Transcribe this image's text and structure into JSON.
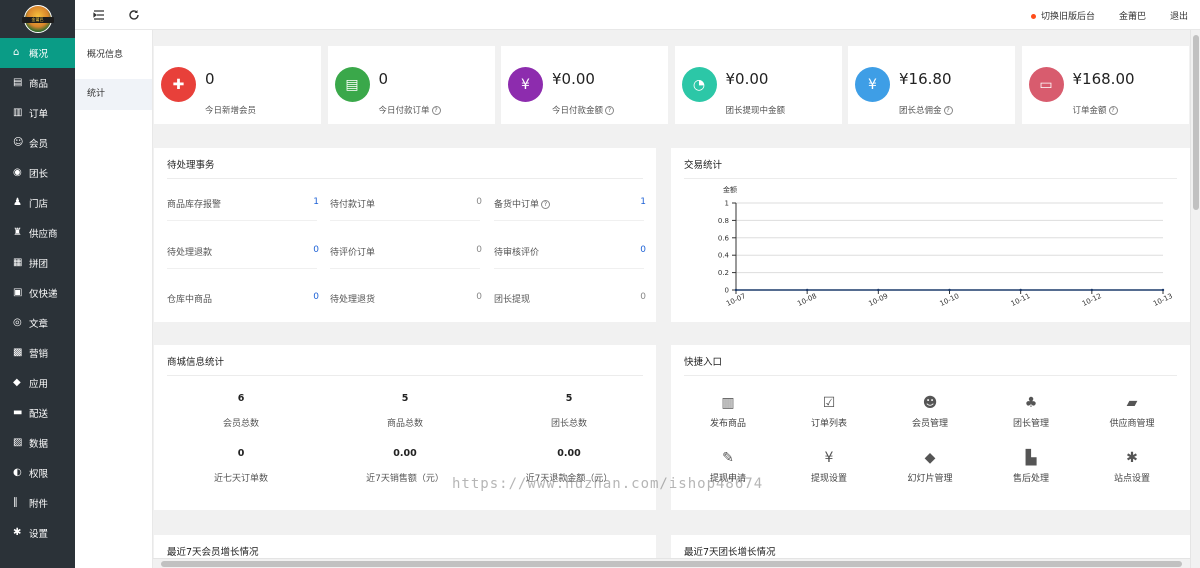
{
  "logo": {
    "text": "金莆巴"
  },
  "sidebar": {
    "items": [
      {
        "label": "概况",
        "icon": "home-icon"
      },
      {
        "label": "商品",
        "icon": "goods-icon"
      },
      {
        "label": "订单",
        "icon": "order-icon"
      },
      {
        "label": "会员",
        "icon": "member-icon"
      },
      {
        "label": "团长",
        "icon": "leader-icon"
      },
      {
        "label": "门店",
        "icon": "store-icon"
      },
      {
        "label": "供应商",
        "icon": "supplier-icon"
      },
      {
        "label": "拼团",
        "icon": "group-icon"
      },
      {
        "label": "仅快递",
        "icon": "express-icon"
      },
      {
        "label": "文章",
        "icon": "article-icon"
      },
      {
        "label": "营销",
        "icon": "marketing-icon"
      },
      {
        "label": "应用",
        "icon": "app-icon"
      },
      {
        "label": "配送",
        "icon": "delivery-icon"
      },
      {
        "label": "数据",
        "icon": "data-icon"
      },
      {
        "label": "权限",
        "icon": "permission-icon"
      },
      {
        "label": "附件",
        "icon": "attachment-icon"
      },
      {
        "label": "设置",
        "icon": "settings-icon"
      }
    ]
  },
  "subnav": {
    "items": [
      "概况信息",
      "统计"
    ]
  },
  "topbar": {
    "switch_label": "切换旧版后台",
    "user": "金莆巴",
    "logout": "退出"
  },
  "stats": [
    {
      "value": "0",
      "label": "今日新增会员",
      "help": false,
      "color": "#e8403a",
      "icon": "add-user-icon"
    },
    {
      "value": "0",
      "label": "今日付款订单",
      "help": true,
      "color": "#3aa84a",
      "icon": "document-icon"
    },
    {
      "value": "¥0.00",
      "label": "今日付款金额",
      "help": true,
      "color": "#8d2cae",
      "icon": "yen-icon"
    },
    {
      "value": "¥0.00",
      "label": "团长提现中金额",
      "help": false,
      "color": "#2cc7a7",
      "icon": "pie-icon"
    },
    {
      "value": "¥16.80",
      "label": "团长总佣金",
      "help": true,
      "color": "#3e9ee6",
      "icon": "money-bag-icon"
    },
    {
      "value": "¥168.00",
      "label": "订单金额",
      "help": true,
      "color": "#d85c6e",
      "icon": "wallet-icon"
    }
  ],
  "todo": {
    "title": "待处理事务",
    "rows": [
      [
        {
          "label": "商品库存报警",
          "value": "1",
          "hl": true
        },
        {
          "label": "待付款订单",
          "value": "0",
          "hl": false
        },
        {
          "label": "备货中订单",
          "value": "1",
          "hl": true,
          "help": true
        }
      ],
      [
        {
          "label": "待处理退款",
          "value": "0",
          "hl": true
        },
        {
          "label": "待评价订单",
          "value": "0",
          "hl": false
        },
        {
          "label": "待审核评价",
          "value": "0",
          "hl": true
        }
      ],
      [
        {
          "label": "仓库中商品",
          "value": "0",
          "hl": true
        },
        {
          "label": "待处理退货",
          "value": "0",
          "hl": false
        },
        {
          "label": "团长提现",
          "value": "0",
          "hl": false
        }
      ]
    ]
  },
  "chart_data": {
    "type": "line",
    "title": "交易统计",
    "ylabel": "金额",
    "xlabel": "",
    "categories": [
      "10-07",
      "10-08",
      "10-09",
      "10-10",
      "10-11",
      "10-12",
      "10-13"
    ],
    "series": [
      {
        "values": [
          0,
          0,
          0,
          0,
          0,
          0,
          0
        ]
      }
    ],
    "ylim": [
      0,
      1
    ],
    "yticks": [
      "0",
      "0.2",
      "0.4",
      "0.6",
      "0.8",
      "1"
    ],
    "grid": true
  },
  "mall": {
    "title": "商城信息统计",
    "items": [
      {
        "value": "6",
        "label": "会员总数"
      },
      {
        "value": "5",
        "label": "商品总数"
      },
      {
        "value": "5",
        "label": "团长总数"
      },
      {
        "value": "0",
        "label": "近七天订单数"
      },
      {
        "value": "0.00",
        "label": "近7天销售额（元）"
      },
      {
        "value": "0.00",
        "label": "近7天退款金额（元）"
      }
    ]
  },
  "quick": {
    "title": "快捷入口",
    "items": [
      {
        "label": "发布商品",
        "icon": "barcode-icon"
      },
      {
        "label": "订单列表",
        "icon": "clipboard-check-icon"
      },
      {
        "label": "会员管理",
        "icon": "member-manage-icon"
      },
      {
        "label": "团长管理",
        "icon": "org-chart-icon"
      },
      {
        "label": "供应商管理",
        "icon": "truck-icon"
      },
      {
        "label": "提现申请",
        "icon": "withdraw-icon"
      },
      {
        "label": "提现设置",
        "icon": "yen-circle-icon"
      },
      {
        "label": "幻灯片管理",
        "icon": "tag-icon"
      },
      {
        "label": "售后处理",
        "icon": "after-sale-icon"
      },
      {
        "label": "站点设置",
        "icon": "gear-icon"
      }
    ]
  },
  "bottom": {
    "left_title": "最近7天会员增长情况",
    "right_title": "最近7天团长增长情况"
  },
  "watermark": "https://www.huzhan.com/ishop48674"
}
